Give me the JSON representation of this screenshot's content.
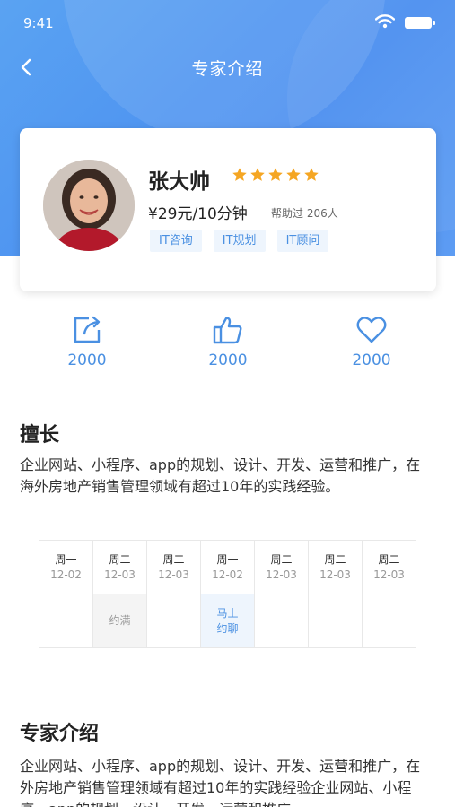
{
  "status": {
    "time": "9:41"
  },
  "nav": {
    "title": "专家介绍"
  },
  "expert": {
    "name": "张大帅",
    "rating": 5,
    "price": "¥29元/10分钟",
    "helped": "帮助过 206人",
    "tags": [
      "IT咨询",
      "IT规划",
      "IT顾问"
    ]
  },
  "actions": {
    "share_count": "2000",
    "like_count": "2000",
    "favorite_count": "2000"
  },
  "specialty": {
    "title": "擅长",
    "text": "企业网站、小程序、app的规划、设计、开发、运营和推广，在海外房地产销售管理领域有超过10年的实践经验。"
  },
  "schedule": {
    "days": [
      {
        "weekday": "周一",
        "date": "12-02",
        "status": ""
      },
      {
        "weekday": "周二",
        "date": "12-03",
        "status": "约满"
      },
      {
        "weekday": "周二",
        "date": "12-03",
        "status": ""
      },
      {
        "weekday": "周一",
        "date": "12-02",
        "status": "马上约聊"
      },
      {
        "weekday": "周二",
        "date": "12-03",
        "status": ""
      },
      {
        "weekday": "周二",
        "date": "12-03",
        "status": ""
      },
      {
        "weekday": "周二",
        "date": "12-03",
        "status": ""
      }
    ]
  },
  "intro": {
    "title": "专家介绍",
    "text": "企业网站、小程序、app的规划、设计、开发、运营和推广，在外房地产销售管理领域有超过10年的实践经验企业网站、小程序、app的规划、设计、开发、运营和推广"
  },
  "colors": {
    "primary": "#4a90e2",
    "star": "#f5a623",
    "header": "#4a8ef0"
  }
}
